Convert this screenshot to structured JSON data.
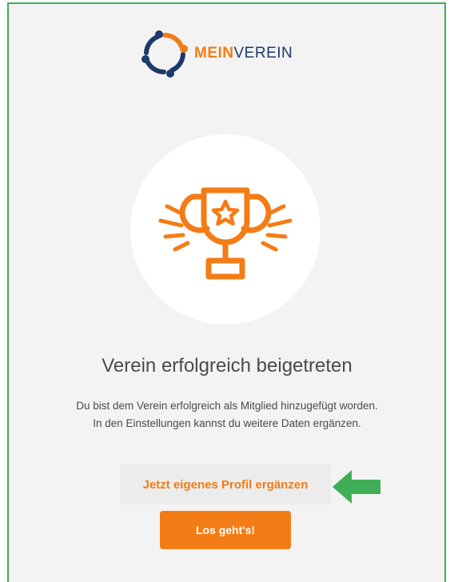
{
  "logo": {
    "text_part1": "MEIN",
    "text_part2": "VEREIN",
    "icon": "people-ring-logo-icon"
  },
  "trophy": {
    "icon": "trophy-star-icon"
  },
  "headline": "Verein erfolgreich beigetreten",
  "description": {
    "line1": "Du bist dem Verein erfolgreich als Mitglied hinzugefügt worden.",
    "line2": "In den Einstellungen kannst du weitere Daten ergänzen."
  },
  "buttons": {
    "complete_profile": "Jetzt eigenes Profil ergänzen",
    "start": "Los geht's!"
  },
  "annotation": {
    "icon": "green-arrow-left-icon"
  },
  "colors": {
    "accent_orange": "#f47c16",
    "brand_navy": "#1c3a6b",
    "border_green": "#3fae55",
    "panel_bg": "#f3f3f3"
  }
}
